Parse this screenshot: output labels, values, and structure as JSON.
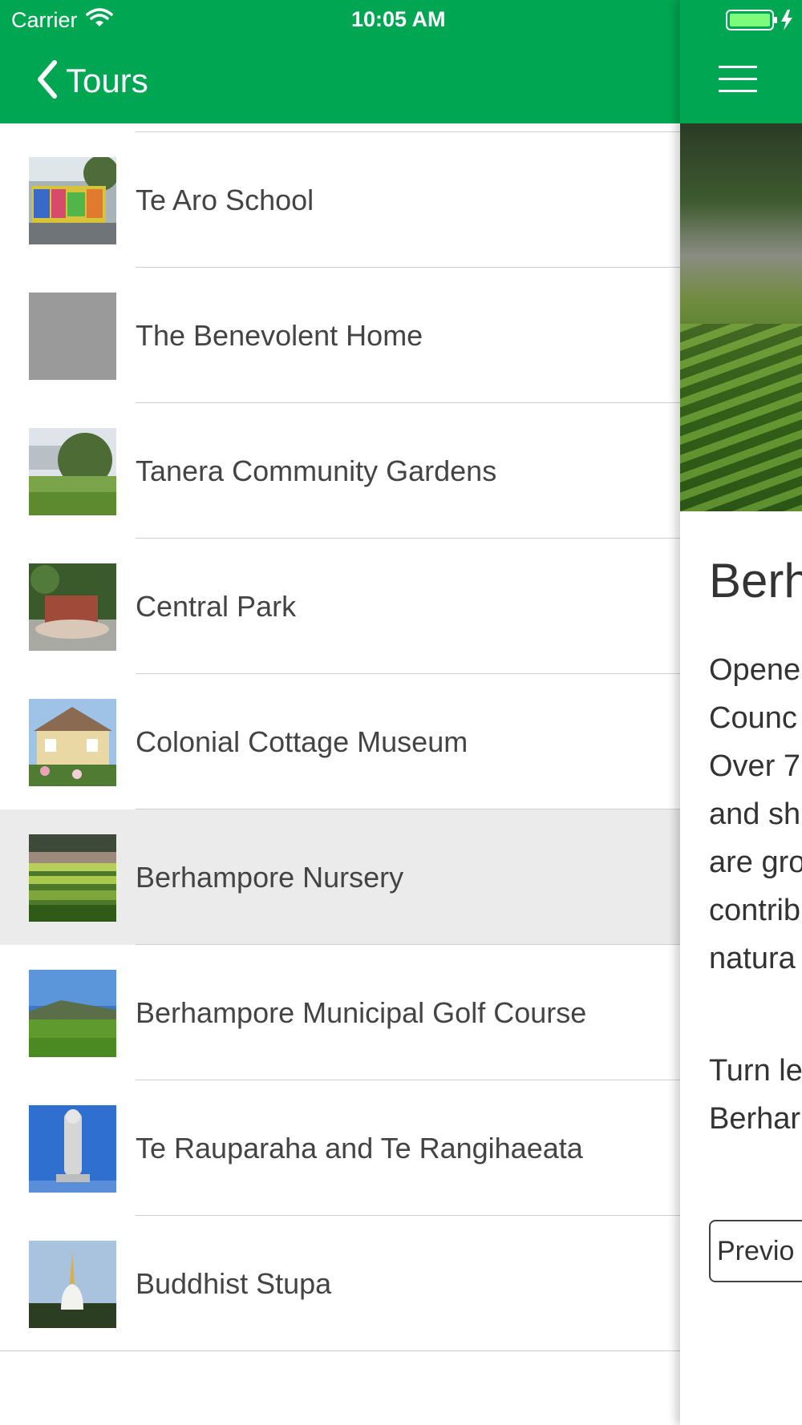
{
  "status_bar": {
    "carrier": "Carrier",
    "time": "10:05 AM",
    "icons": [
      "wifi-icon",
      "battery-icon",
      "charging-bolt-icon"
    ]
  },
  "nav": {
    "back_label": "Tours",
    "back_icon": "chevron-left-icon",
    "menu_icon": "hamburger-menu-icon"
  },
  "colors": {
    "brand_green": "#00a651",
    "selected_row": "#ebebeb"
  },
  "tours": [
    {
      "label": "Te Aro School",
      "thumb": "colorful-school-mural"
    },
    {
      "label": "The Benevolent Home",
      "thumb": "placeholder-gray"
    },
    {
      "label": "Tanera Community Gardens",
      "thumb": "garden-hillside"
    },
    {
      "label": "Central Park",
      "thumb": "park-brick-planter"
    },
    {
      "label": "Colonial Cottage Museum",
      "thumb": "cottage-house"
    },
    {
      "label": "Berhampore Nursery",
      "thumb": "nursery-rows",
      "selected": true
    },
    {
      "label": "Berhampore Municipal Golf Course",
      "thumb": "golf-green"
    },
    {
      "label": "Te Rauparaha and Te Rangihaeata",
      "thumb": "carved-statue"
    },
    {
      "label": "Buddhist Stupa",
      "thumb": "white-stupa"
    }
  ],
  "detail": {
    "title": "Berh",
    "paragraph_lines": [
      "Opene",
      "Counc",
      "Over 7",
      "and sh",
      "are gro",
      "contrib",
      "natura"
    ],
    "paragraph2_lines": [
      "Turn le",
      "Berhar"
    ],
    "prev_button": "Previo"
  }
}
